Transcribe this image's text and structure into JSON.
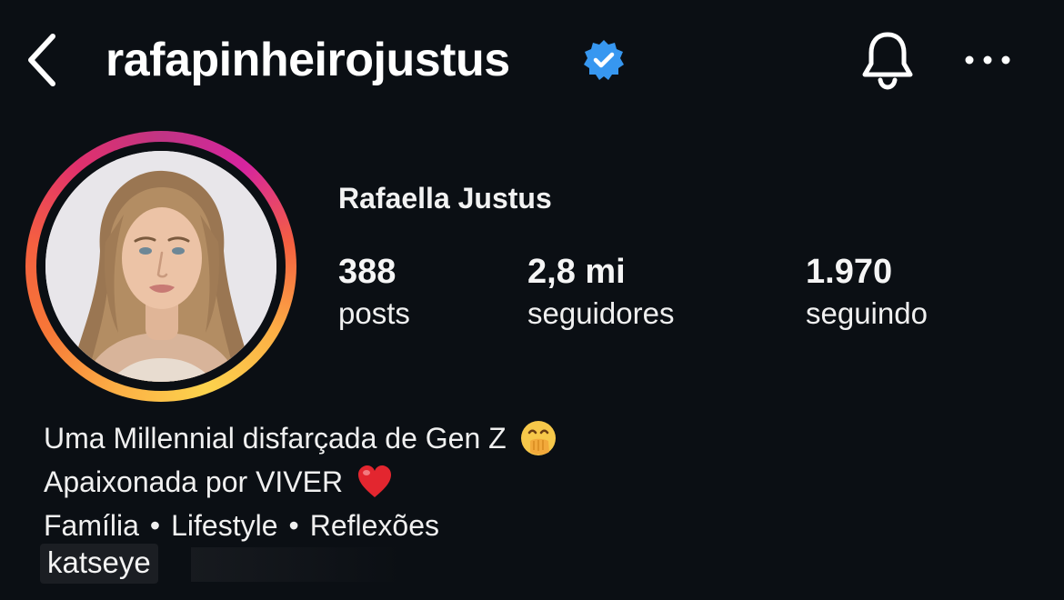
{
  "header": {
    "username": "rafapinheirojustus",
    "icons": {
      "back": "chevron-left-icon",
      "verified": "verified-badge-icon",
      "notifications": "bell-icon",
      "more": "more-horizontal-icon"
    }
  },
  "profile": {
    "display_name": "Rafaella Justus",
    "avatar_ring_colors": [
      "#fcaf45",
      "#f56040",
      "#e1306c",
      "#c13584"
    ],
    "stats": [
      {
        "value": "388",
        "label": "posts"
      },
      {
        "value": "2,8 mi",
        "label": "seguidores"
      },
      {
        "value": "1.970",
        "label": "seguindo"
      }
    ]
  },
  "bio": {
    "line1": "Uma Millennial disfarçada de Gen Z",
    "line1_emoji": "face-with-hand-over-mouth-emoji",
    "line2": "Apaixonada por VIVER",
    "line2_emoji": "red-heart-emoji",
    "line3_items": [
      "Família",
      "Lifestyle",
      "Reflexões"
    ],
    "separator": "•"
  },
  "overlay_text": "katseye",
  "colors": {
    "background": "#0b0f14",
    "text": "#f5f5f5",
    "verified_blue": "#3797f0"
  }
}
